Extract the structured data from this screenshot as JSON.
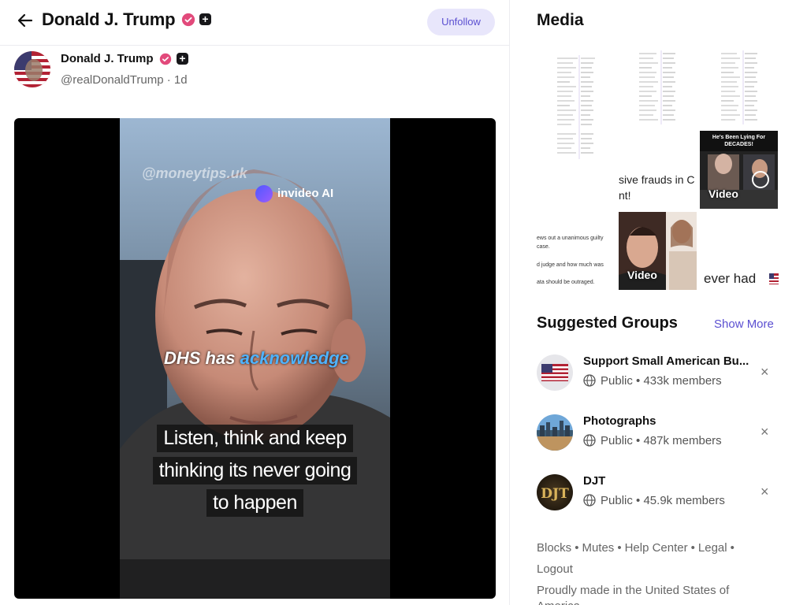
{
  "header": {
    "title": "Donald J. Trump",
    "unfollow_label": "Unfollow"
  },
  "post": {
    "author_name": "Donald J. Trump",
    "handle": "@realDonaldTrump",
    "time": "· 1d",
    "video": {
      "watermark": "@moneytips.uk",
      "brand": "invideo AI",
      "caption_prefix": "DHS has",
      "caption_highlight": "acknowledge",
      "subtitle_lines": [
        "Listen, think and keep",
        "thinking its never going",
        "to happen"
      ]
    }
  },
  "media": {
    "title": "Media",
    "video_label_1": "Video",
    "video_label_2": "Video",
    "video1_headline": "He's Been Lying For DECADES!",
    "snippet_1a": "sive frauds in C",
    "snippet_1b": "nt!",
    "snippet_2": "ever had",
    "tiny_1": "ews out a unanimous guilty",
    "tiny_2": "case.",
    "tiny_3": "d judge and how much was",
    "tiny_4": "ata should be outraged."
  },
  "groups": {
    "title": "Suggested Groups",
    "show_more": "Show More",
    "items": [
      {
        "name": "Support Small American Bu...",
        "visibility": "Public",
        "members": "433k members"
      },
      {
        "name": "Photographs",
        "visibility": "Public",
        "members": "487k members"
      },
      {
        "name": "DJT",
        "visibility": "Public",
        "members": "45.9k members"
      }
    ],
    "separator": "•",
    "close": "×"
  },
  "footer": {
    "links": [
      "Blocks",
      "Mutes",
      "Help Center",
      "Legal",
      "Logout"
    ],
    "made_in": "Proudly made in the United States of America"
  },
  "colors": {
    "accent": "#5b4fd1",
    "unfollow_bg": "#e8e6fb",
    "verified": "#e24a7b"
  }
}
